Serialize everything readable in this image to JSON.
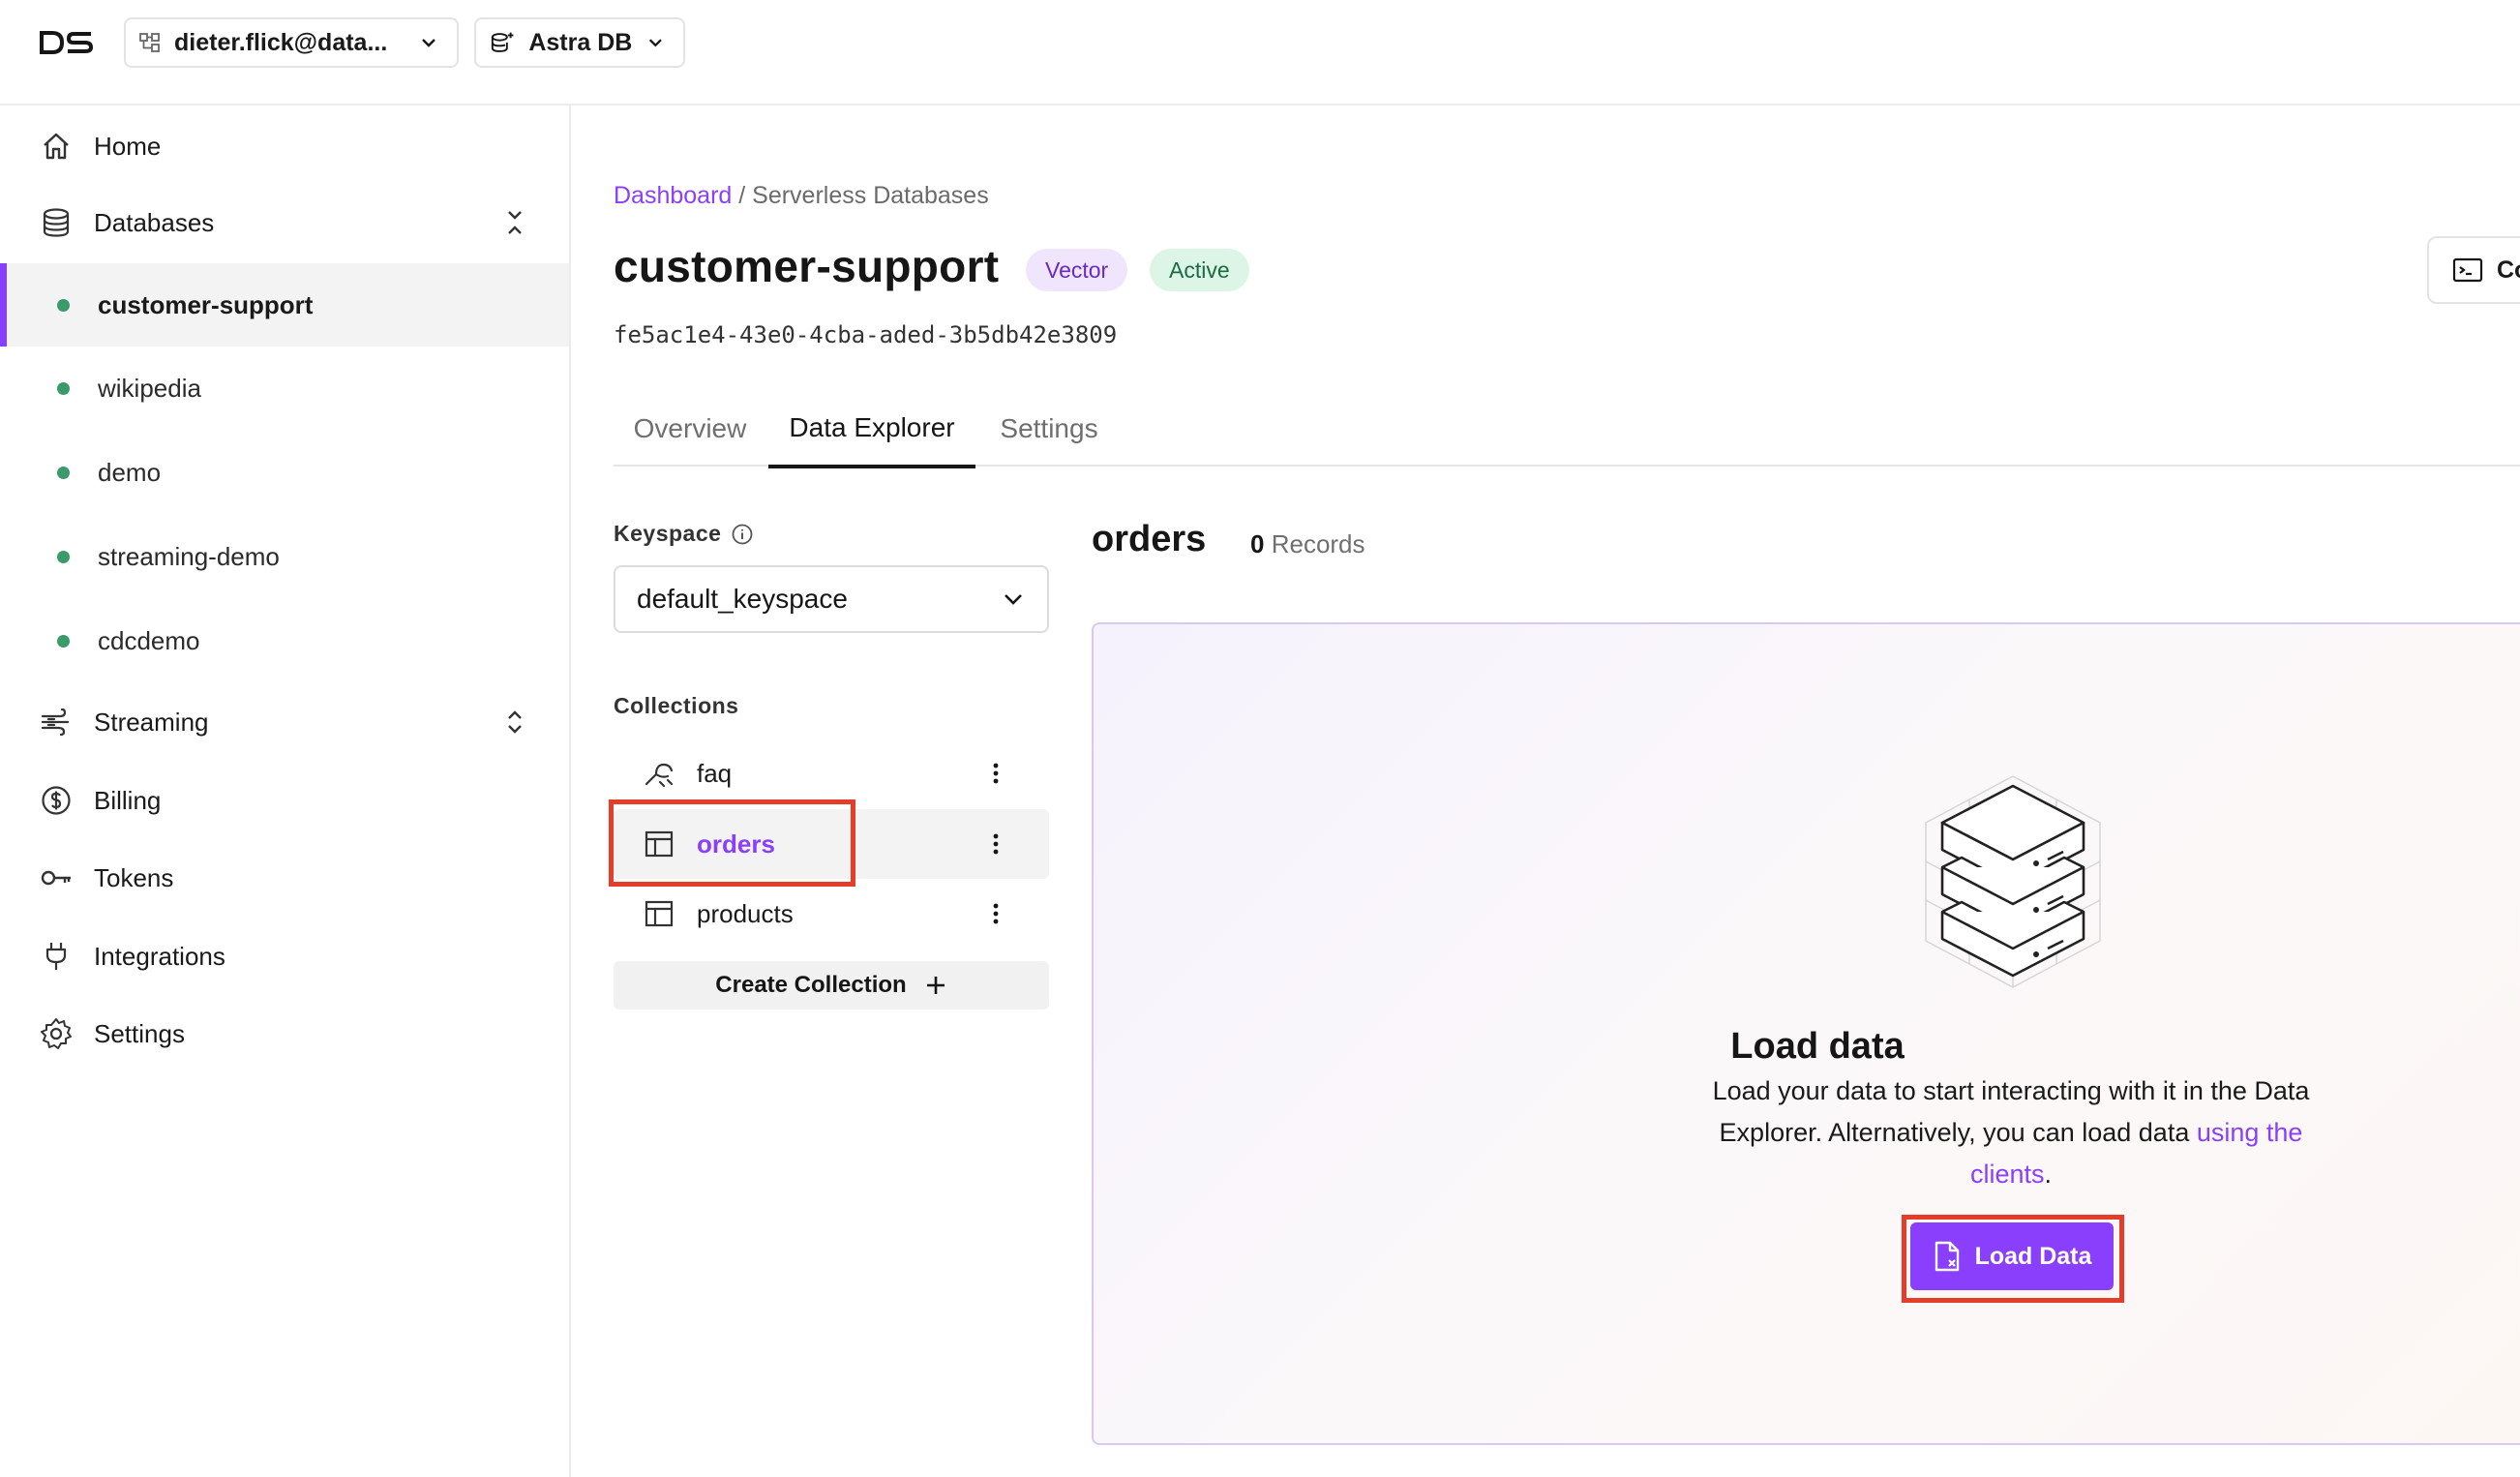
{
  "header": {
    "org_selector": "dieter.flick@data...",
    "product_selector": "Astra DB"
  },
  "sidebar": {
    "home": "Home",
    "databases": "Databases",
    "database_items": [
      "customer-support",
      "wikipedia",
      "demo",
      "streaming-demo",
      "cdcdemo"
    ],
    "streaming": "Streaming",
    "billing": "Billing",
    "tokens": "Tokens",
    "integrations": "Integrations",
    "settings": "Settings"
  },
  "breadcrumb": {
    "link": "Dashboard",
    "separator": " / ",
    "current": "Serverless Databases"
  },
  "database": {
    "name": "customer-support",
    "type_badge": "Vector",
    "status_badge": "Active",
    "id": "fe5ac1e4-43e0-4cba-aded-3b5db42e3809",
    "connect_label": "Co"
  },
  "tabs": [
    "Overview",
    "Data Explorer",
    "Settings"
  ],
  "explorer": {
    "keyspace_label": "Keyspace",
    "keyspace_value": "default_keyspace",
    "collections_label": "Collections",
    "collections": [
      "faq",
      "orders",
      "products"
    ],
    "create_collection": "Create Collection",
    "selected_collection": "orders",
    "record_count": "0",
    "records_label": "Records"
  },
  "empty_state": {
    "title": "Load data",
    "desc_before": "Load your data to start interacting with it in the Data Explorer. Alternatively, you can load data ",
    "link": "using the clients",
    "desc_after": ".",
    "button": "Load Data"
  },
  "colors": {
    "accent": "#8a3ffc",
    "status_dot": "#3a9a6a",
    "highlight": "#e43d2a"
  }
}
